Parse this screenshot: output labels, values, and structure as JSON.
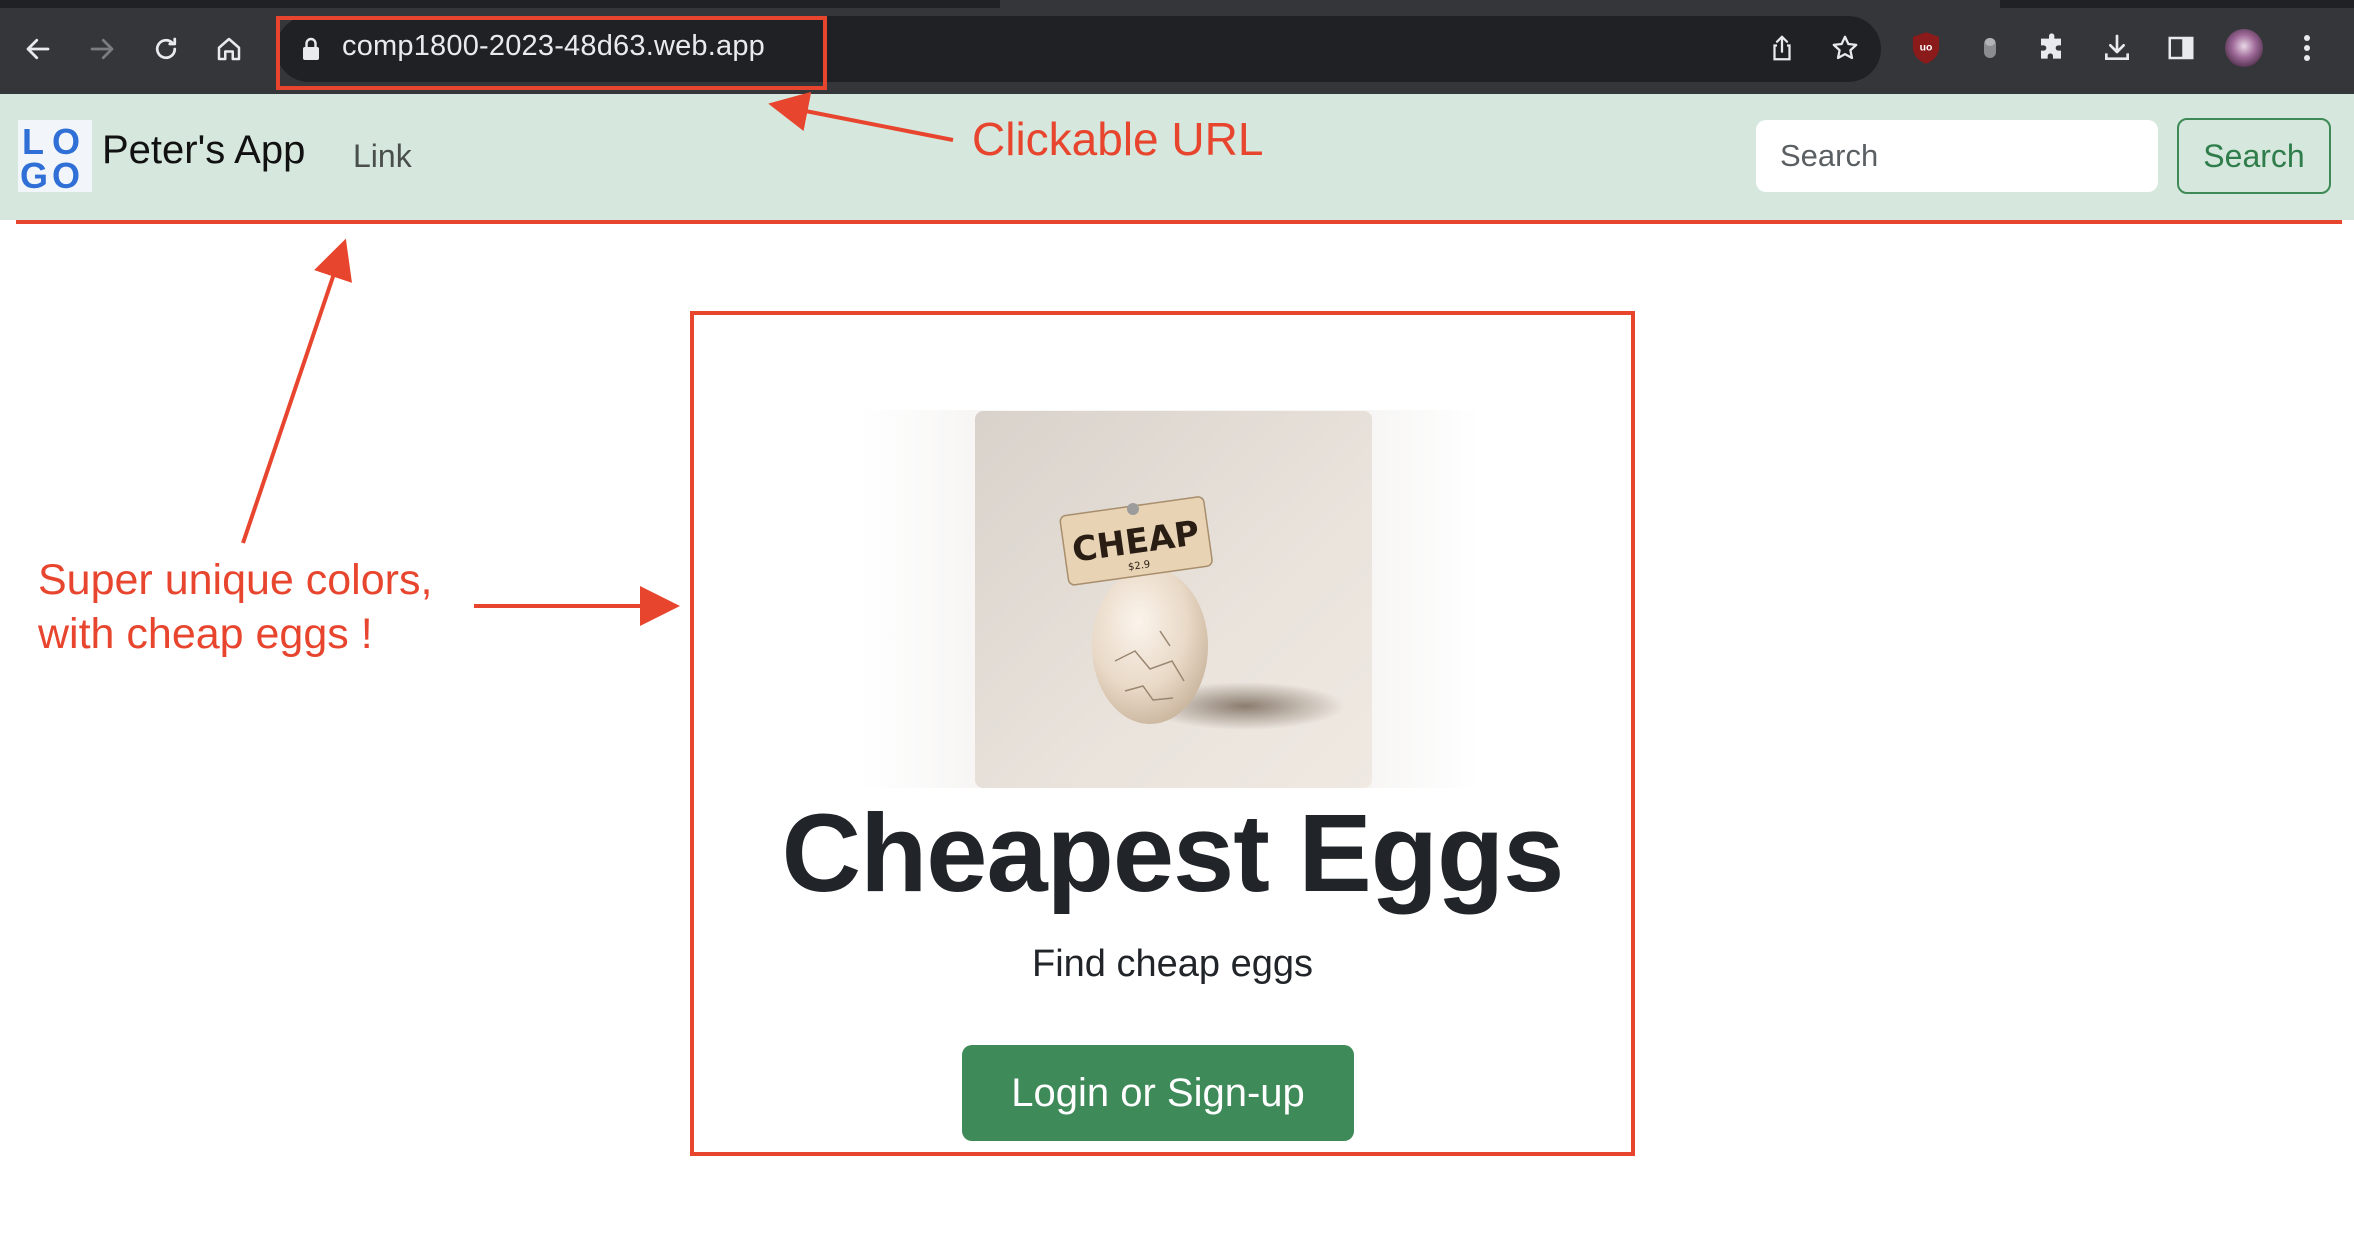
{
  "browser": {
    "url": "comp1800-2023-48d63.web.app",
    "icons": [
      "back-arrow-icon",
      "forward-arrow-icon",
      "reload-icon",
      "home-icon",
      "lock-icon",
      "share-icon",
      "star-icon",
      "ublock-icon",
      "extension-icon",
      "puzzle-icon",
      "download-icon",
      "sidepanel-icon",
      "profile-avatar",
      "kebab-menu-icon"
    ]
  },
  "navbar": {
    "logo_text": "LOGO",
    "brand": "Peter's App",
    "link": "Link",
    "search_placeholder": "Search",
    "search_button": "Search"
  },
  "hero": {
    "image_sign": "CHEAP",
    "title": "Cheapest Eggs",
    "subtitle": "Find cheap eggs",
    "cta": "Login or Sign-up"
  },
  "annotations": {
    "url_note": "Clickable URL",
    "colors_note_line1": "Super unique colors,",
    "colors_note_line2": "with cheap eggs !"
  },
  "colors": {
    "navbar_bg": "#d6e7dd",
    "accent_green": "#3f8a59",
    "annotation_red": "#e8452e",
    "chrome_bg": "#35363a"
  }
}
